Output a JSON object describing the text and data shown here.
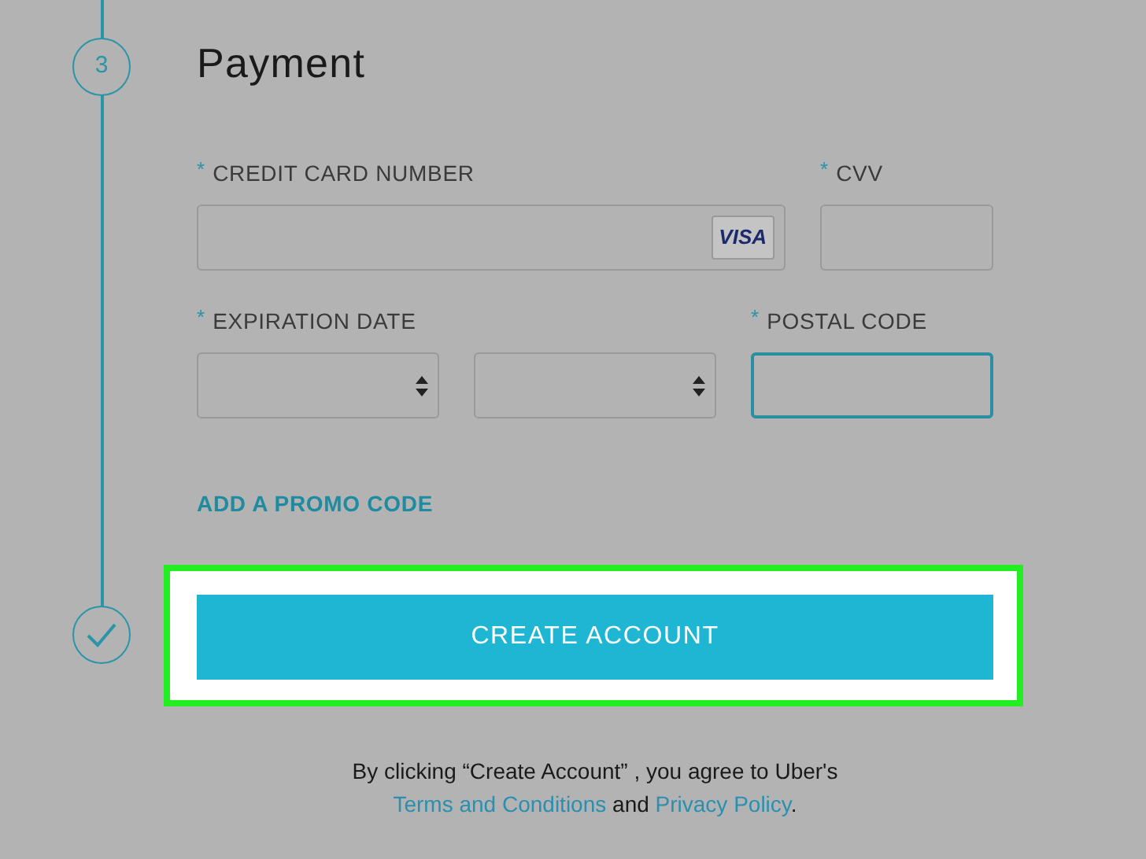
{
  "steps": [
    {
      "number": "3",
      "kind": "number"
    },
    {
      "kind": "check"
    }
  ],
  "section_title": "Payment",
  "field_rows": [
    {
      "labels": [
        {
          "text": "CREDIT CARD NUMBER",
          "marker": "*"
        },
        {
          "text": "CVV",
          "marker": "*"
        }
      ],
      "fields": [
        {
          "kind": "input",
          "focused": false,
          "badge": "VISA"
        },
        {
          "kind": "input",
          "focused": false
        }
      ]
    },
    {
      "labels": [
        {
          "text": "EXPIRATION DATE",
          "marker": "*"
        },
        {
          "text": "POSTAL CODE",
          "marker": "*"
        }
      ],
      "fields": [
        {
          "kind": "select",
          "focused": false
        },
        {
          "kind": "select",
          "focused": false
        },
        {
          "kind": "input",
          "focused": true
        }
      ]
    }
  ],
  "promo_link": "ADD A PROMO CODE",
  "submit": {
    "label": "CREATE ACCOUNT",
    "highlighted": true
  },
  "notice": {
    "text": "By clicking “Create Account” , you agree to Uber's",
    "link_1": "Terms and Conditions",
    "joiner": "and",
    "link_2": "Privacy Policy",
    "end": "."
  }
}
